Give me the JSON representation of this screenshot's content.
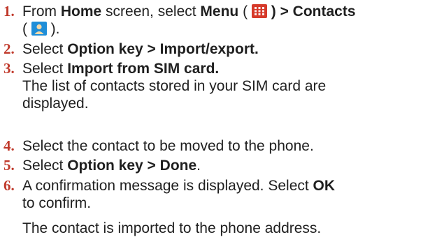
{
  "steps": [
    {
      "number": "1.",
      "t1": "From ",
      "b1": "Home",
      "t2": " screen, select ",
      "b2": "Menu",
      "t3": " ( ",
      "icon1": "menu-grid-icon",
      "b3": " ) > Contacts",
      "t4": "( ",
      "icon2": "contacts-person-icon",
      "t5": " )."
    },
    {
      "number": "2.",
      "t1": "Select ",
      "b1": "Option key > Import/export."
    },
    {
      "number": "3.",
      "t1": "Select ",
      "b1": "Import from SIM card.",
      "detail": "The list of contacts stored in your SIM card are displayed."
    },
    {
      "number": "4.",
      "t1": "Select the contact to be moved to the phone."
    },
    {
      "number": "5.",
      "t1": "Select ",
      "b1": "Option key > Done",
      "t2": "."
    },
    {
      "number": "6.",
      "t1": "A confirmation message is displayed. Select ",
      "b1": "OK",
      "t2": "to confirm."
    }
  ],
  "footer_note": "The contact is imported to the phone address.",
  "colors": {
    "step_number": "#c0392b",
    "menu_icon_bg": "#d63a2a",
    "contacts_icon_bg": "#1f8ed8",
    "text": "#1f1f1f"
  }
}
